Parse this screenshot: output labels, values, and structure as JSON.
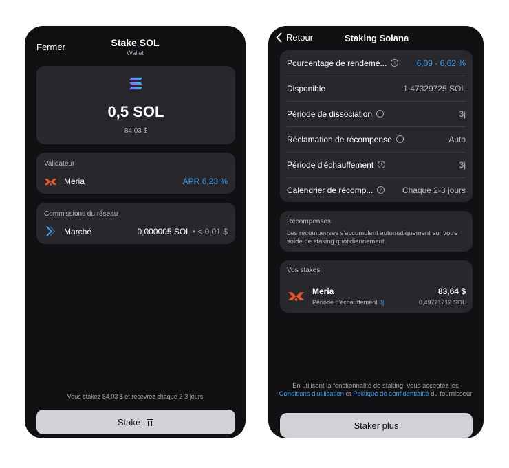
{
  "left": {
    "close_label": "Fermer",
    "title": "Stake SOL",
    "subtitle": "Wallet",
    "amount": "0,5 SOL",
    "amount_usd": "84,03 $",
    "validator": {
      "heading": "Validateur",
      "name": "Meria",
      "apr": "APR 6,23 %"
    },
    "fees": {
      "heading": "Commissions du réseau",
      "name": "Marché",
      "value": "0,000005 SOL",
      "separator": " • ",
      "usd": "< 0,01 $"
    },
    "footnote": "Vous stakez 84,03 $ et recevrez chaque 2-3 jours",
    "stake_button": "Stake"
  },
  "right": {
    "back_label": "Retour",
    "title": "Staking Solana",
    "info_rows": [
      {
        "label": "Pourcentage de rendeme...",
        "value": "6,09 - 6,62 %",
        "info": true
      },
      {
        "label": "Disponible",
        "value": "1,47329725 SOL",
        "info": false
      },
      {
        "label": "Période de dissociation",
        "value": "3j",
        "info": true
      },
      {
        "label": "Réclamation de récompense",
        "value": "Auto",
        "info": true
      },
      {
        "label": "Période d'échauffement",
        "value": "3j",
        "info": true
      },
      {
        "label": "Calendrier de récomp...",
        "value": "Chaque 2-3 jours",
        "info": true
      }
    ],
    "rewards": {
      "heading": "Récompenses",
      "text": "Les récompenses s'accumulent automatiquement sur votre solde de staking quotidiennement."
    },
    "stakes": {
      "heading": "Vos stakes",
      "name": "Meria",
      "period_label": "Période d'échauffement",
      "period_value": "3j",
      "usd": "83,64 $",
      "sol": "0,49771712 SOL"
    },
    "terms": {
      "prefix": "En utilisant la fonctionnalité de staking, vous acceptez les",
      "link1": "Conditions d'utilisation",
      "and": " et ",
      "link2": "Politique de confidentialité",
      "suffix": " du fournisseur"
    },
    "stake_more_button": "Staker plus"
  },
  "colors": {
    "accent_blue": "#3b9cf0",
    "card_bg": "#28282c",
    "screen_bg": "#111113",
    "meria_orange": "#e8562a"
  },
  "icons": [
    "solana-logo-icon",
    "meria-logo-icon",
    "market-icon",
    "info-icon",
    "back-chevron-icon",
    "stake-icon"
  ]
}
